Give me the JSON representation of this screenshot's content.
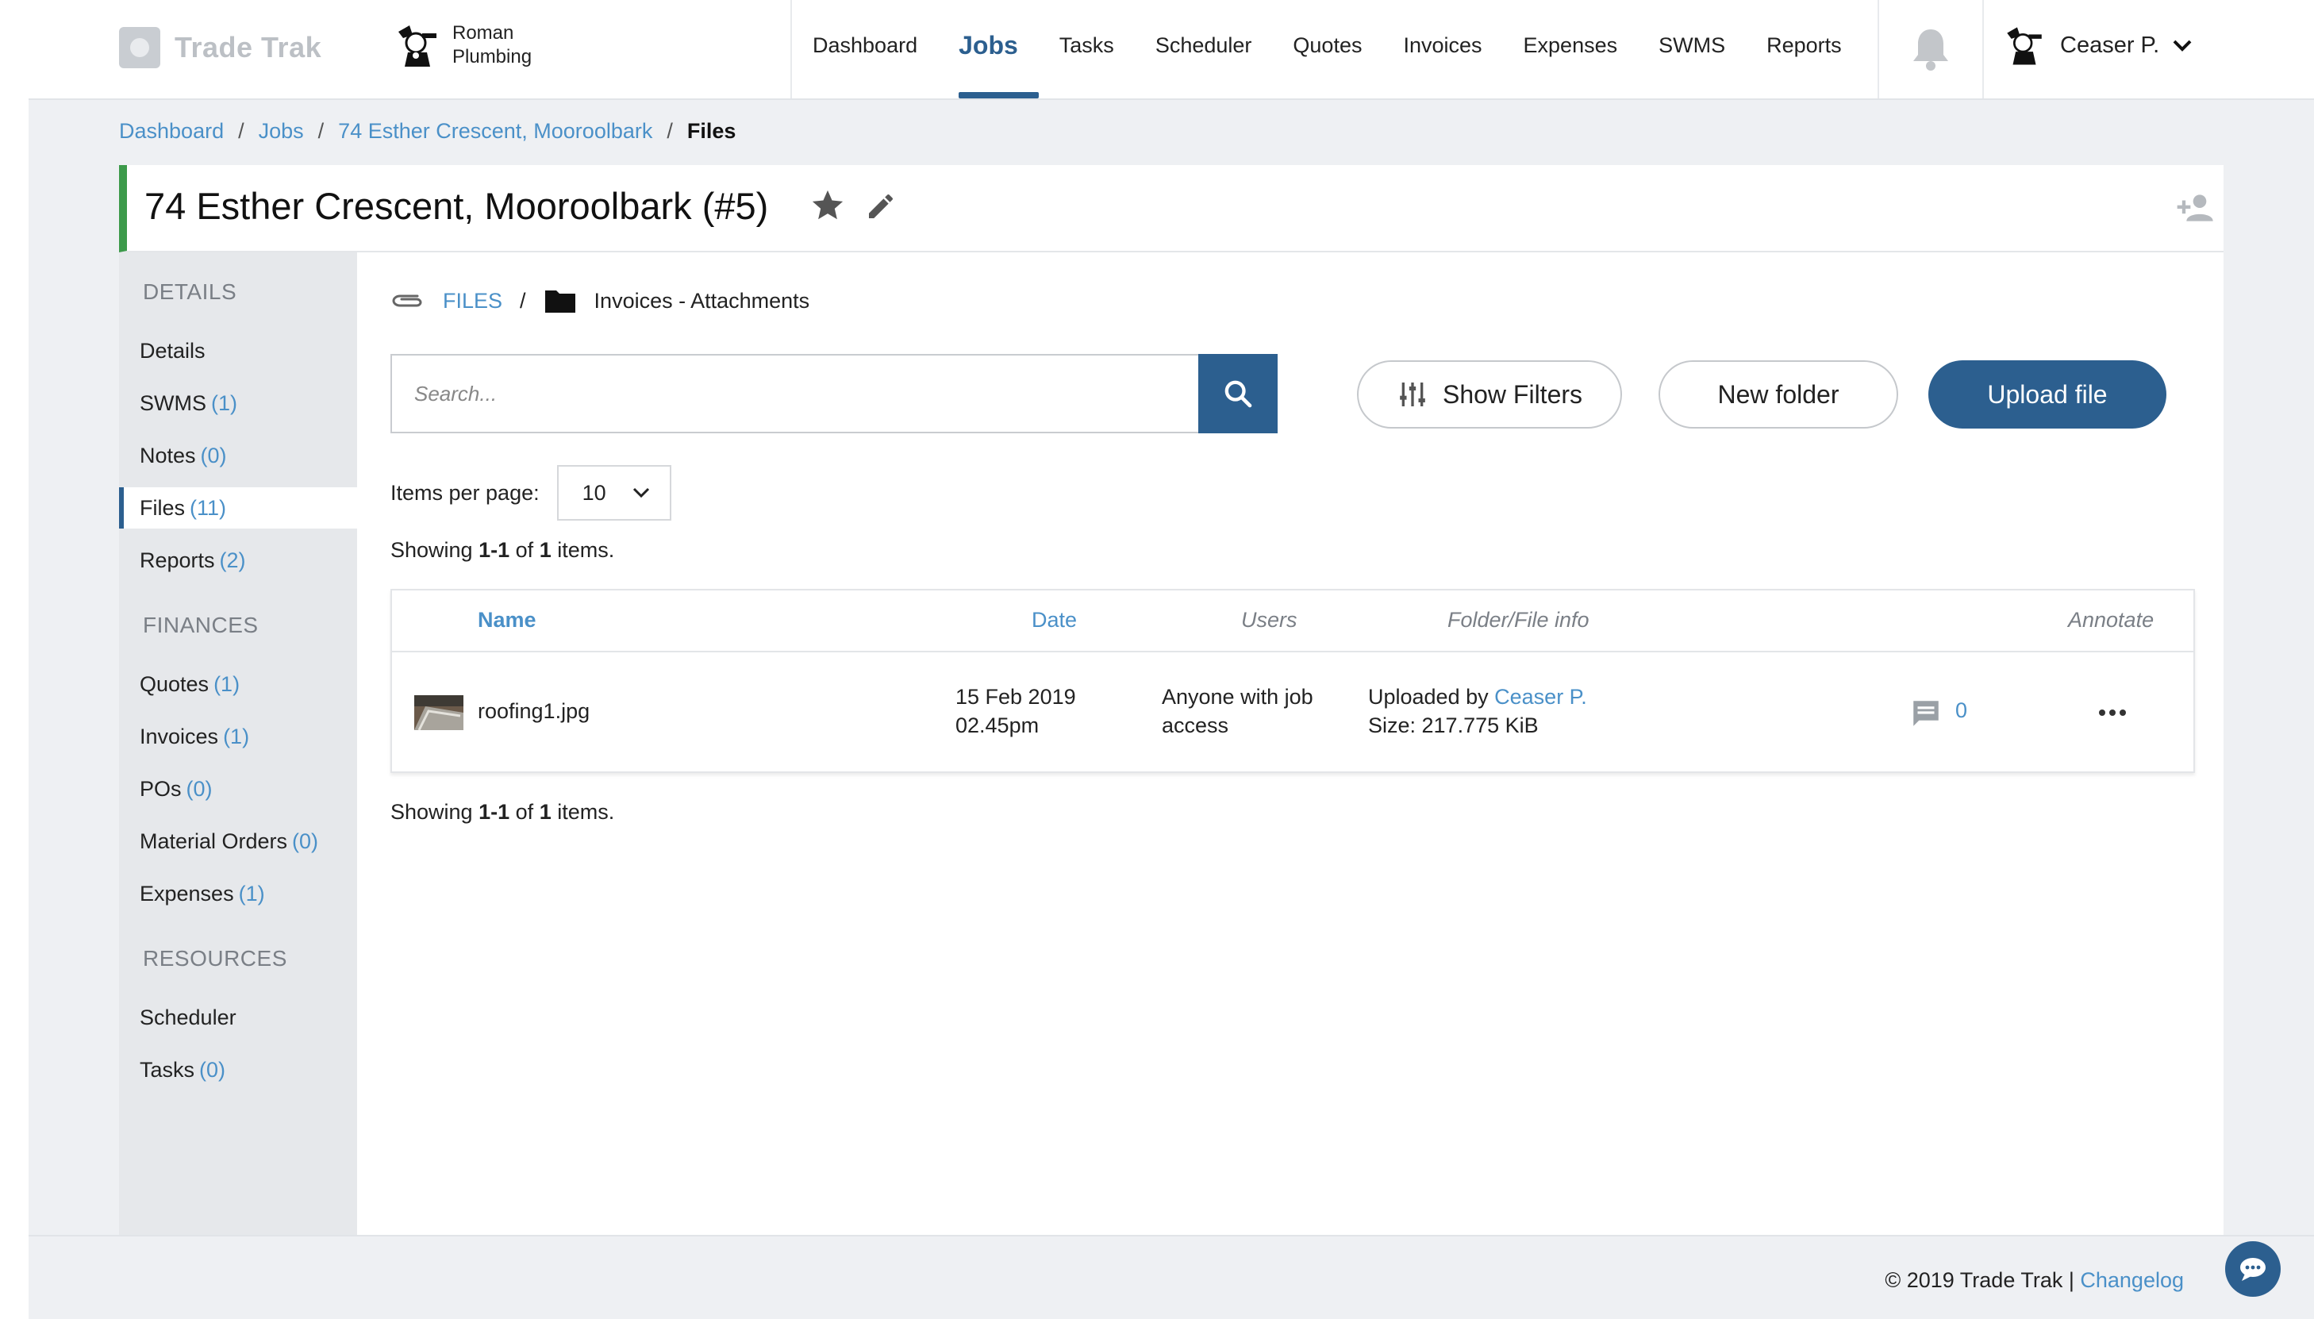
{
  "brand": {
    "name": "Trade Trak",
    "company_line1": "Roman",
    "company_line2": "Plumbing"
  },
  "nav": {
    "items": [
      {
        "label": "Dashboard",
        "active": false
      },
      {
        "label": "Jobs",
        "active": true
      },
      {
        "label": "Tasks",
        "active": false
      },
      {
        "label": "Scheduler",
        "active": false
      },
      {
        "label": "Quotes",
        "active": false
      },
      {
        "label": "Invoices",
        "active": false
      },
      {
        "label": "Expenses",
        "active": false
      },
      {
        "label": "SWMS",
        "active": false
      },
      {
        "label": "Reports",
        "active": false
      }
    ],
    "bell_icon": "bell-icon",
    "user_name": "Ceaser P."
  },
  "breadcrumb": {
    "items": [
      "Dashboard",
      "Jobs",
      "74 Esther Crescent, Mooroolbark"
    ],
    "current": "Files"
  },
  "job": {
    "title": "74 Esther Crescent, Mooroolbark (#5)",
    "accent_color": "#3c9a4a"
  },
  "sidebar": {
    "sections": [
      {
        "title": "DETAILS",
        "items": [
          {
            "label": "Details",
            "count": ""
          },
          {
            "label": "SWMS",
            "count": "(1)"
          },
          {
            "label": "Notes",
            "count": "(0)"
          },
          {
            "label": "Files",
            "count": "(11)",
            "active": true
          },
          {
            "label": "Reports",
            "count": "(2)"
          }
        ]
      },
      {
        "title": "FINANCES",
        "items": [
          {
            "label": "Quotes",
            "count": "(1)"
          },
          {
            "label": "Invoices",
            "count": "(1)"
          },
          {
            "label": "POs",
            "count": "(0)"
          },
          {
            "label": "Material Orders",
            "count": "(0)"
          },
          {
            "label": "Expenses",
            "count": "(1)"
          }
        ]
      },
      {
        "title": "RESOURCES",
        "items": [
          {
            "label": "Scheduler",
            "count": ""
          },
          {
            "label": "Tasks",
            "count": "(0)"
          }
        ]
      }
    ]
  },
  "files": {
    "root_label": "FILES",
    "separator": "/",
    "folder_name": "Invoices - Attachments",
    "search_placeholder": "Search...",
    "show_filters_label": "Show Filters",
    "new_folder_label": "New folder",
    "upload_label": "Upload file",
    "items_per_page_label": "Items per page:",
    "items_per_page_value": "10",
    "summary": {
      "prefix": "Showing",
      "range": "1-1",
      "of": "of",
      "total": "1",
      "suffix": "items."
    },
    "columns": [
      "Name",
      "Date",
      "Users",
      "Folder/File info",
      "Annotate"
    ],
    "rows": [
      {
        "name": "roofing1.jpg",
        "date_line1": "15 Feb 2019",
        "date_line2": "02.45pm",
        "users_line1": "Anyone with job",
        "users_line2": "access",
        "uploaded_by_label": "Uploaded by",
        "uploaded_by": "Ceaser P.",
        "size": "Size: 217.775 KiB",
        "comments": "0"
      }
    ]
  },
  "footer": {
    "copyright": "© 2019 Trade Trak |",
    "changelog": "Changelog"
  },
  "colors": {
    "primary": "#2c5f8f",
    "link": "#4a90c8",
    "sidebar_bg": "#e6e8eb"
  }
}
